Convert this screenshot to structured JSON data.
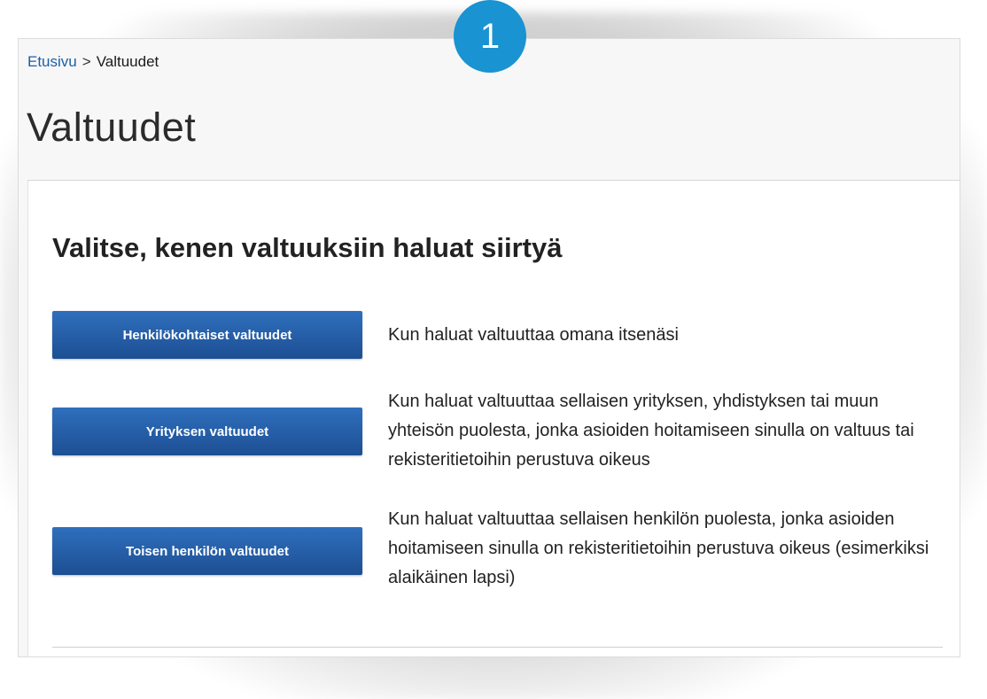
{
  "badge": {
    "number": "1"
  },
  "breadcrumb": {
    "home": "Etusivu",
    "separator": ">",
    "current": "Valtuudet"
  },
  "page": {
    "title": "Valtuudet"
  },
  "card": {
    "heading": "Valitse, kenen valtuuksiin haluat siirtyä",
    "options": [
      {
        "button": "Henkilökohtaiset valtuudet",
        "description": "Kun haluat valtuuttaa omana itsenäsi"
      },
      {
        "button": "Yrityksen valtuudet",
        "description": "Kun haluat valtuuttaa sellaisen yrityksen, yhdistyksen tai muun yhteisön puolesta, jonka asioiden hoitamiseen sinulla on valtuus tai rekisteritietoihin perustuva oikeus"
      },
      {
        "button": "Toisen henkilön valtuudet",
        "description": "Kun haluat valtuuttaa sellaisen henkilön puolesta, jonka asioiden hoitamiseen sinulla on rekisteritietoihin perustuva oikeus (esimerkiksi alaikäinen lapsi)"
      }
    ]
  },
  "colors": {
    "link": "#1d5fa8",
    "button": "#245aa3",
    "badge": "#1993d1"
  }
}
